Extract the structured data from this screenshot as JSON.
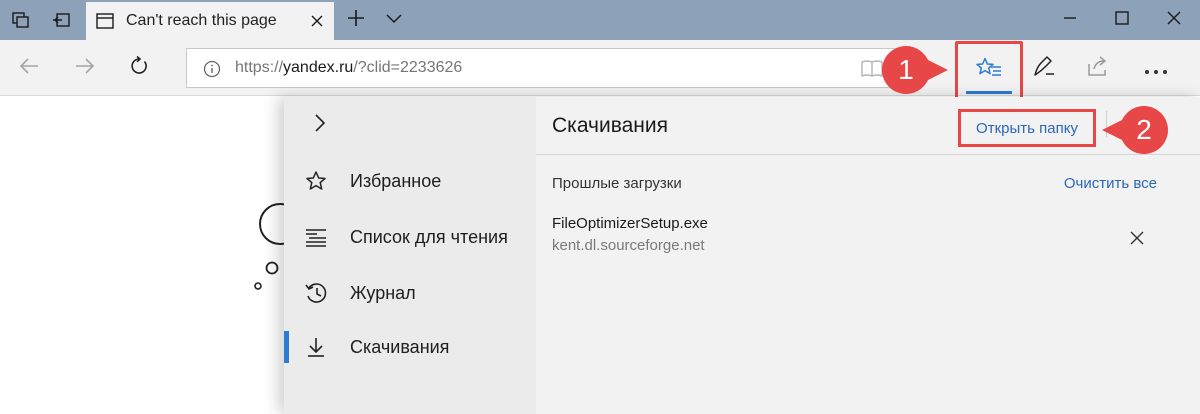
{
  "window": {
    "tab_title": "Can't reach this page"
  },
  "address_bar": {
    "url_scheme": "https://",
    "url_host": "yandex.ru",
    "url_path": "/?clid=2233626"
  },
  "hub": {
    "nav_items": [
      {
        "label": "Избранное",
        "icon": "star-icon"
      },
      {
        "label": "Список для чтения",
        "icon": "reading-list-icon"
      },
      {
        "label": "Журнал",
        "icon": "history-icon"
      },
      {
        "label": "Скачивания",
        "icon": "download-icon",
        "selected": true
      }
    ],
    "content": {
      "title": "Скачивания",
      "open_folder_label": "Открыть папку",
      "past_downloads_label": "Прошлые загрузки",
      "clear_all_label": "Очистить все",
      "downloads": [
        {
          "file_name": "FileOptimizerSetup.exe",
          "source": "kent.dl.sourceforge.net"
        }
      ]
    }
  },
  "annotations": {
    "step_1": "1",
    "step_2": "2",
    "color": "#e74747"
  },
  "colors": {
    "titlebar": "#8da1b8",
    "accent": "#2b7cd3",
    "link": "#2b67b7"
  }
}
